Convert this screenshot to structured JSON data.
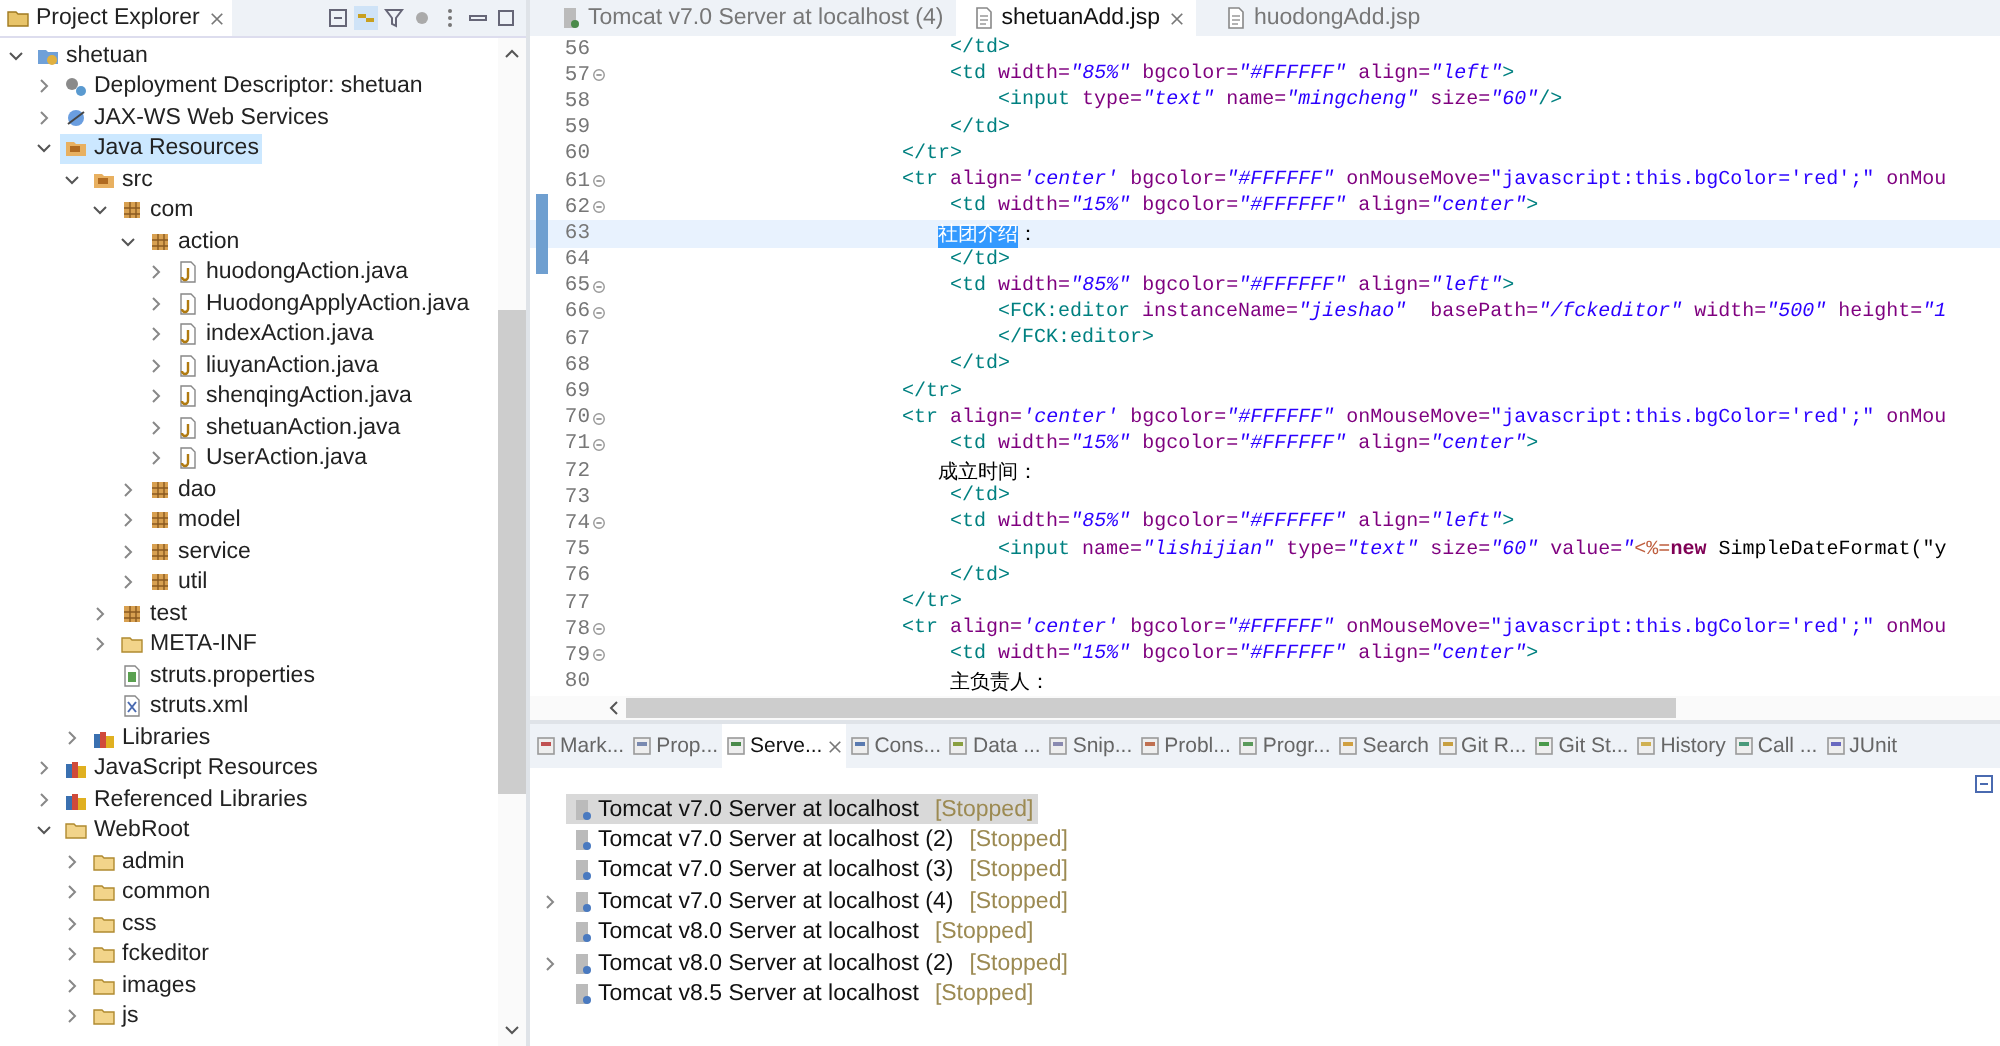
{
  "explorer": {
    "title": "Project Explorer",
    "tree": [
      {
        "label": "shetuan",
        "kind": "project",
        "expanded": true,
        "selected": false,
        "children": [
          {
            "label": "Deployment Descriptor: shetuan",
            "kind": "descriptor",
            "expanded": false,
            "selected": false
          },
          {
            "label": "JAX-WS Web Services",
            "kind": "webservices",
            "expanded": false,
            "selected": false
          },
          {
            "label": "Java Resources",
            "kind": "resources",
            "expanded": true,
            "selected": true,
            "children": [
              {
                "label": "src",
                "kind": "srcfolder",
                "expanded": true,
                "selected": false,
                "children": [
                  {
                    "label": "com",
                    "kind": "package",
                    "expanded": true,
                    "selected": false,
                    "children": [
                      {
                        "label": "action",
                        "kind": "package",
                        "expanded": true,
                        "selected": false,
                        "children": [
                          {
                            "label": "huodongAction.java",
                            "kind": "java",
                            "expanded": false,
                            "selected": false
                          },
                          {
                            "label": "HuodongApplyAction.java",
                            "kind": "java",
                            "expanded": false,
                            "selected": false
                          },
                          {
                            "label": "indexAction.java",
                            "kind": "java",
                            "expanded": false,
                            "selected": false
                          },
                          {
                            "label": "liuyanAction.java",
                            "kind": "java",
                            "expanded": false,
                            "selected": false
                          },
                          {
                            "label": "shenqingAction.java",
                            "kind": "java",
                            "expanded": false,
                            "selected": false
                          },
                          {
                            "label": "shetuanAction.java",
                            "kind": "java",
                            "expanded": false,
                            "selected": false
                          },
                          {
                            "label": "UserAction.java",
                            "kind": "java",
                            "expanded": false,
                            "selected": false
                          }
                        ]
                      },
                      {
                        "label": "dao",
                        "kind": "package",
                        "expanded": false,
                        "selected": false
                      },
                      {
                        "label": "model",
                        "kind": "package",
                        "expanded": false,
                        "selected": false
                      },
                      {
                        "label": "service",
                        "kind": "package",
                        "expanded": false,
                        "selected": false
                      },
                      {
                        "label": "util",
                        "kind": "package",
                        "expanded": false,
                        "selected": false
                      }
                    ]
                  },
                  {
                    "label": "test",
                    "kind": "package",
                    "expanded": false,
                    "selected": false
                  },
                  {
                    "label": "META-INF",
                    "kind": "folder",
                    "expanded": false,
                    "selected": false
                  },
                  {
                    "label": "struts.properties",
                    "kind": "properties",
                    "selected": false
                  },
                  {
                    "label": "struts.xml",
                    "kind": "xml",
                    "selected": false
                  }
                ]
              },
              {
                "label": "Libraries",
                "kind": "library",
                "expanded": false,
                "selected": false
              }
            ]
          },
          {
            "label": "JavaScript Resources",
            "kind": "library",
            "expanded": false,
            "selected": false
          },
          {
            "label": "Referenced Libraries",
            "kind": "library",
            "expanded": false,
            "selected": false
          },
          {
            "label": "WebRoot",
            "kind": "folder",
            "expanded": true,
            "selected": false,
            "children": [
              {
                "label": "admin",
                "kind": "folder",
                "expanded": false,
                "selected": false
              },
              {
                "label": "common",
                "kind": "folder",
                "expanded": false,
                "selected": false
              },
              {
                "label": "css",
                "kind": "folder",
                "expanded": false,
                "selected": false
              },
              {
                "label": "fckeditor",
                "kind": "folder",
                "expanded": false,
                "selected": false
              },
              {
                "label": "images",
                "kind": "folder",
                "expanded": false,
                "selected": false
              },
              {
                "label": "js",
                "kind": "folder",
                "expanded": false,
                "selected": false
              }
            ]
          }
        ]
      }
    ]
  },
  "editor": {
    "tabs": [
      {
        "label": "Tomcat v7.0 Server at localhost (4)",
        "kind": "server",
        "selected": false
      },
      {
        "label": "shetuanAdd.jsp",
        "kind": "file",
        "selected": true
      },
      {
        "label": "huodongAdd.jsp",
        "kind": "file",
        "selected": false
      }
    ],
    "lines": [
      {
        "number": "56",
        "fold": false,
        "changed": false,
        "current": false,
        "tokens": [
          {
            "kind": "tag",
            "text": "                            </td>"
          }
        ]
      },
      {
        "number": "57",
        "fold": true,
        "changed": false,
        "current": false,
        "tokens": [
          {
            "kind": "tag",
            "text": "                            <td"
          },
          {
            "kind": "attr",
            "text": " width="
          },
          {
            "kind": "value",
            "text": "\"85%\""
          },
          {
            "kind": "attr",
            "text": " bgcolor="
          },
          {
            "kind": "value",
            "text": "\"#FFFFFF\""
          },
          {
            "kind": "attr",
            "text": " align="
          },
          {
            "kind": "value",
            "text": "\"left\""
          },
          {
            "kind": "tag",
            "text": ">"
          }
        ]
      },
      {
        "number": "58",
        "fold": false,
        "changed": false,
        "current": false,
        "tokens": [
          {
            "kind": "tag",
            "text": "                                <input"
          },
          {
            "kind": "attr",
            "text": " type="
          },
          {
            "kind": "value",
            "text": "\"text\""
          },
          {
            "kind": "attr",
            "text": " name="
          },
          {
            "kind": "value",
            "text": "\"mingcheng\""
          },
          {
            "kind": "attr",
            "text": " size="
          },
          {
            "kind": "value",
            "text": "\"60\""
          },
          {
            "kind": "tag",
            "text": "/>"
          }
        ]
      },
      {
        "number": "59",
        "fold": false,
        "changed": false,
        "current": false,
        "tokens": [
          {
            "kind": "tag",
            "text": "                            </td>"
          }
        ]
      },
      {
        "number": "60",
        "fold": false,
        "changed": false,
        "current": false,
        "tokens": [
          {
            "kind": "tag",
            "text": "                        </tr>"
          }
        ]
      },
      {
        "number": "61",
        "fold": true,
        "changed": false,
        "current": false,
        "tokens": [
          {
            "kind": "tag",
            "text": "                        <tr"
          },
          {
            "kind": "attr",
            "text": " align="
          },
          {
            "kind": "value",
            "text": "'center'"
          },
          {
            "kind": "attr",
            "text": " bgcolor="
          },
          {
            "kind": "value",
            "text": "\"#FFFFFF\""
          },
          {
            "kind": "attr",
            "text": " onMouseMove="
          },
          {
            "kind": "script",
            "text": "\"javascript:this.bgColor='red';\""
          },
          {
            "kind": "attr",
            "text": " onMou"
          }
        ]
      },
      {
        "number": "62",
        "fold": true,
        "changed": true,
        "current": false,
        "tokens": [
          {
            "kind": "tag",
            "text": "                            <td"
          },
          {
            "kind": "attr",
            "text": " width="
          },
          {
            "kind": "value",
            "text": "\"15%\""
          },
          {
            "kind": "attr",
            "text": " bgcolor="
          },
          {
            "kind": "value",
            "text": "\"#FFFFFF\""
          },
          {
            "kind": "attr",
            "text": " align="
          },
          {
            "kind": "value",
            "text": "\"center\""
          },
          {
            "kind": "tag",
            "text": ">"
          }
        ]
      },
      {
        "number": "63",
        "fold": false,
        "changed": true,
        "current": true,
        "tokens": [
          {
            "kind": "selection",
            "text": "                           社团介绍"
          },
          {
            "kind": "text",
            "text": "："
          }
        ]
      },
      {
        "number": "64",
        "fold": false,
        "changed": true,
        "current": false,
        "tokens": [
          {
            "kind": "tag",
            "text": "                            </td>"
          }
        ]
      },
      {
        "number": "65",
        "fold": true,
        "changed": false,
        "current": false,
        "tokens": [
          {
            "kind": "tag",
            "text": "                            <td"
          },
          {
            "kind": "attr",
            "text": " width="
          },
          {
            "kind": "value",
            "text": "\"85%\""
          },
          {
            "kind": "attr",
            "text": " bgcolor="
          },
          {
            "kind": "value",
            "text": "\"#FFFFFF\""
          },
          {
            "kind": "attr",
            "text": " align="
          },
          {
            "kind": "value",
            "text": "\"left\""
          },
          {
            "kind": "tag",
            "text": ">"
          }
        ]
      },
      {
        "number": "66",
        "fold": true,
        "changed": false,
        "current": false,
        "tokens": [
          {
            "kind": "tag",
            "text": "                                <FCK:editor"
          },
          {
            "kind": "attr",
            "text": " instanceName="
          },
          {
            "kind": "value",
            "text": "\"jieshao\""
          },
          {
            "kind": "attr",
            "text": "  basePath="
          },
          {
            "kind": "value",
            "text": "\"/fckeditor\""
          },
          {
            "kind": "attr",
            "text": " width="
          },
          {
            "kind": "value",
            "text": "\"500\""
          },
          {
            "kind": "attr",
            "text": " height="
          },
          {
            "kind": "value",
            "text": "\"1"
          }
        ]
      },
      {
        "number": "67",
        "fold": false,
        "changed": false,
        "current": false,
        "tokens": [
          {
            "kind": "tag",
            "text": "                                </FCK:editor>"
          }
        ]
      },
      {
        "number": "68",
        "fold": false,
        "changed": false,
        "current": false,
        "tokens": [
          {
            "kind": "tag",
            "text": "                            </td>"
          }
        ]
      },
      {
        "number": "69",
        "fold": false,
        "changed": false,
        "current": false,
        "tokens": [
          {
            "kind": "tag",
            "text": "                        </tr>"
          }
        ]
      },
      {
        "number": "70",
        "fold": true,
        "changed": false,
        "current": false,
        "tokens": [
          {
            "kind": "tag",
            "text": "                        <tr"
          },
          {
            "kind": "attr",
            "text": " align="
          },
          {
            "kind": "value",
            "text": "'center'"
          },
          {
            "kind": "attr",
            "text": " bgcolor="
          },
          {
            "kind": "value",
            "text": "\"#FFFFFF\""
          },
          {
            "kind": "attr",
            "text": " onMouseMove="
          },
          {
            "kind": "script",
            "text": "\"javascript:this.bgColor='red';\""
          },
          {
            "kind": "attr",
            "text": " onMou"
          }
        ]
      },
      {
        "number": "71",
        "fold": true,
        "changed": false,
        "current": false,
        "tokens": [
          {
            "kind": "tag",
            "text": "                            <td"
          },
          {
            "kind": "attr",
            "text": " width="
          },
          {
            "kind": "value",
            "text": "\"15%\""
          },
          {
            "kind": "attr",
            "text": " bgcolor="
          },
          {
            "kind": "value",
            "text": "\"#FFFFFF\""
          },
          {
            "kind": "attr",
            "text": " align="
          },
          {
            "kind": "value",
            "text": "\"center\""
          },
          {
            "kind": "tag",
            "text": ">"
          }
        ]
      },
      {
        "number": "72",
        "fold": false,
        "changed": false,
        "current": false,
        "tokens": [
          {
            "kind": "text",
            "text": "                           成立时间："
          }
        ]
      },
      {
        "number": "73",
        "fold": false,
        "changed": false,
        "current": false,
        "tokens": [
          {
            "kind": "tag",
            "text": "                            </td>"
          }
        ]
      },
      {
        "number": "74",
        "fold": true,
        "changed": false,
        "current": false,
        "tokens": [
          {
            "kind": "tag",
            "text": "                            <td"
          },
          {
            "kind": "attr",
            "text": " width="
          },
          {
            "kind": "value",
            "text": "\"85%\""
          },
          {
            "kind": "attr",
            "text": " bgcolor="
          },
          {
            "kind": "value",
            "text": "\"#FFFFFF\""
          },
          {
            "kind": "attr",
            "text": " align="
          },
          {
            "kind": "value",
            "text": "\"left\""
          },
          {
            "kind": "tag",
            "text": ">"
          }
        ]
      },
      {
        "number": "75",
        "fold": false,
        "changed": false,
        "current": false,
        "tokens": [
          {
            "kind": "tag",
            "text": "                                <input"
          },
          {
            "kind": "attr",
            "text": " name="
          },
          {
            "kind": "value",
            "text": "\"lishijian\""
          },
          {
            "kind": "attr",
            "text": " type="
          },
          {
            "kind": "value",
            "text": "\"text\""
          },
          {
            "kind": "attr",
            "text": " size="
          },
          {
            "kind": "value",
            "text": "\"60\""
          },
          {
            "kind": "attr",
            "text": " value="
          },
          {
            "kind": "value",
            "text": "\""
          },
          {
            "kind": "jsp",
            "text": "<%="
          },
          {
            "kind": "keyword",
            "text": "new"
          },
          {
            "kind": "text",
            "text": " SimpleDateFormat(\"y"
          }
        ]
      },
      {
        "number": "76",
        "fold": false,
        "changed": false,
        "current": false,
        "tokens": [
          {
            "kind": "tag",
            "text": "                            </td>"
          }
        ]
      },
      {
        "number": "77",
        "fold": false,
        "changed": false,
        "current": false,
        "tokens": [
          {
            "kind": "tag",
            "text": "                        </tr>"
          }
        ]
      },
      {
        "number": "78",
        "fold": true,
        "changed": false,
        "current": false,
        "tokens": [
          {
            "kind": "tag",
            "text": "                        <tr"
          },
          {
            "kind": "attr",
            "text": " align="
          },
          {
            "kind": "value",
            "text": "'center'"
          },
          {
            "kind": "attr",
            "text": " bgcolor="
          },
          {
            "kind": "value",
            "text": "\"#FFFFFF\""
          },
          {
            "kind": "attr",
            "text": " onMouseMove="
          },
          {
            "kind": "script",
            "text": "\"javascript:this.bgColor='red';\""
          },
          {
            "kind": "attr",
            "text": " onMou"
          }
        ]
      },
      {
        "number": "79",
        "fold": true,
        "changed": false,
        "current": false,
        "tokens": [
          {
            "kind": "tag",
            "text": "                            <td"
          },
          {
            "kind": "attr",
            "text": " width="
          },
          {
            "kind": "value",
            "text": "\"15%\""
          },
          {
            "kind": "attr",
            "text": " bgcolor="
          },
          {
            "kind": "value",
            "text": "\"#FFFFFF\""
          },
          {
            "kind": "attr",
            "text": " align="
          },
          {
            "kind": "value",
            "text": "\"center\""
          },
          {
            "kind": "tag",
            "text": ">"
          }
        ]
      },
      {
        "number": "80",
        "fold": false,
        "changed": false,
        "current": false,
        "tokens": [
          {
            "kind": "text",
            "text": "                            主负责人："
          }
        ]
      }
    ]
  },
  "views": {
    "tabs": [
      {
        "label": "Mark...",
        "selected": false
      },
      {
        "label": "Prop...",
        "selected": false
      },
      {
        "label": "Serve...",
        "selected": true
      },
      {
        "label": "Cons...",
        "selected": false
      },
      {
        "label": "Data ...",
        "selected": false
      },
      {
        "label": "Snip...",
        "selected": false
      },
      {
        "label": "Probl...",
        "selected": false
      },
      {
        "label": "Progr...",
        "selected": false
      },
      {
        "label": "Search",
        "selected": false
      },
      {
        "label": "Git R...",
        "selected": false
      },
      {
        "label": "Git St...",
        "selected": false
      },
      {
        "label": "History",
        "selected": false
      },
      {
        "label": "Call ...",
        "selected": false
      },
      {
        "label": "JUnit",
        "selected": false
      }
    ],
    "servers": [
      {
        "name": "Tomcat v7.0 Server at localhost",
        "status": "[Stopped]",
        "selected": true
      },
      {
        "name": "Tomcat v7.0 Server at localhost (2)",
        "status": "[Stopped]",
        "selected": false
      },
      {
        "name": "Tomcat v7.0 Server at localhost (3)",
        "status": "[Stopped]",
        "selected": false
      },
      {
        "name": "Tomcat v7.0 Server at localhost (4)",
        "status": "[Stopped]",
        "selected": false,
        "expanded": false
      },
      {
        "name": "Tomcat v8.0 Server at localhost",
        "status": "[Stopped]",
        "selected": false
      },
      {
        "name": "Tomcat v8.0 Server at localhost (2)",
        "status": "[Stopped]",
        "selected": false,
        "expanded": false
      },
      {
        "name": "Tomcat v8.5 Server at localhost",
        "status": "[Stopped]",
        "selected": false
      }
    ]
  }
}
